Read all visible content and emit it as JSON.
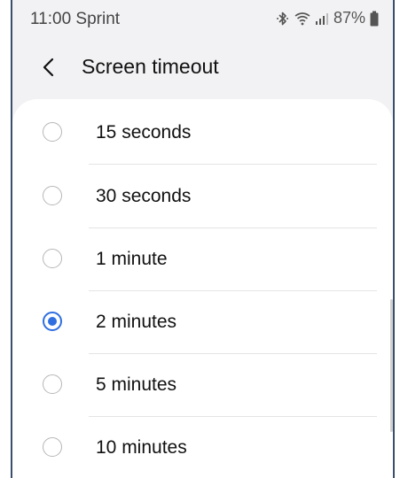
{
  "status_bar": {
    "time_carrier": "11:00 Sprint",
    "battery": "87%",
    "icons": [
      "bluetooth-icon",
      "wifi-icon",
      "signal-icon",
      "battery-icon"
    ]
  },
  "header": {
    "back_icon": "chevron-left-icon",
    "title": "Screen timeout"
  },
  "options": [
    {
      "label": "15 seconds",
      "selected": false
    },
    {
      "label": "30 seconds",
      "selected": false
    },
    {
      "label": "1 minute",
      "selected": false
    },
    {
      "label": "2 minutes",
      "selected": true
    },
    {
      "label": "5 minutes",
      "selected": false
    },
    {
      "label": "10 minutes",
      "selected": false
    }
  ],
  "colors": {
    "accent": "#2f6fe0",
    "background": "#f2f2f4",
    "card": "#ffffff",
    "frame": "#3a4f6e"
  }
}
